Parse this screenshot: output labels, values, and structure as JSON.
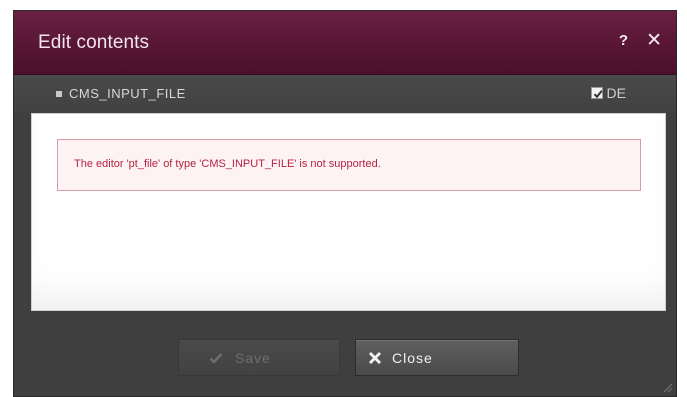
{
  "dialog": {
    "title": "Edit contents",
    "help_label": "?",
    "close_label": "✕"
  },
  "field": {
    "name": "CMS_INPUT_FILE",
    "language": "DE",
    "language_checked": true
  },
  "content": {
    "error_message": "The editor 'pt_file' of type 'CMS_INPUT_FILE' is not supported."
  },
  "buttons": {
    "save_label": "Save",
    "save_enabled": false,
    "close_label": "Close"
  },
  "colors": {
    "titlebar": "#561533",
    "dialog_bg": "#3f3f3f",
    "error_text": "#b4243d",
    "error_border": "#d99aa9"
  },
  "icons": {
    "help": "question-mark-icon",
    "close": "close-x-icon",
    "checkbox": "checkbox-icon",
    "save": "check-icon",
    "close_button": "x-icon",
    "resize": "resize-grip-icon"
  }
}
